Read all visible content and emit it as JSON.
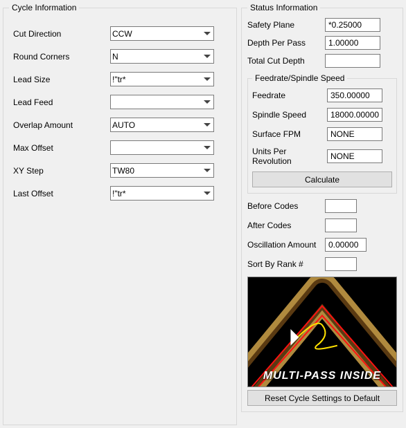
{
  "cycle": {
    "legend": "Cycle Information",
    "cut_direction": {
      "label": "Cut Direction",
      "value": "CCW"
    },
    "round_corners": {
      "label": "Round Corners",
      "value": "N"
    },
    "lead_size": {
      "label": "Lead Size",
      "value": "!\"tr*"
    },
    "lead_feed": {
      "label": "Lead Feed",
      "value": ""
    },
    "overlap_amount": {
      "label": "Overlap Amount",
      "value": "AUTO"
    },
    "max_offset": {
      "label": "Max Offset",
      "value": ""
    },
    "xy_step": {
      "label": "XY Step",
      "value": "TW80"
    },
    "last_offset": {
      "label": "Last Offset",
      "value": "!\"tr*"
    }
  },
  "status": {
    "legend": "Status Information",
    "safety_plane": {
      "label": "Safety Plane",
      "value": "*0.25000"
    },
    "depth_per_pass": {
      "label": "Depth Per Pass",
      "value": "1.00000"
    },
    "total_cut_depth": {
      "label": "Total Cut Depth",
      "value": ""
    },
    "feedrate_group": {
      "legend": "Feedrate/Spindle Speed",
      "feedrate": {
        "label": "Feedrate",
        "value": "350.00000"
      },
      "spindle_speed": {
        "label": "Spindle Speed",
        "value": "18000.00000"
      },
      "surface_fpm": {
        "label": "Surface FPM",
        "value": "NONE"
      },
      "units_per_rev": {
        "label": "Units Per Revolution",
        "value": "NONE"
      },
      "calculate_label": "Calculate"
    },
    "before_codes": {
      "label": "Before Codes",
      "value": ""
    },
    "after_codes": {
      "label": "After Codes",
      "value": ""
    },
    "oscillation": {
      "label": "Oscillation Amount",
      "value": "0.00000"
    },
    "sort_rank": {
      "label": "Sort By Rank #",
      "value": ""
    },
    "preview_label": "MULTI-PASS INSIDE",
    "reset_label": "Reset Cycle Settings to Default"
  }
}
